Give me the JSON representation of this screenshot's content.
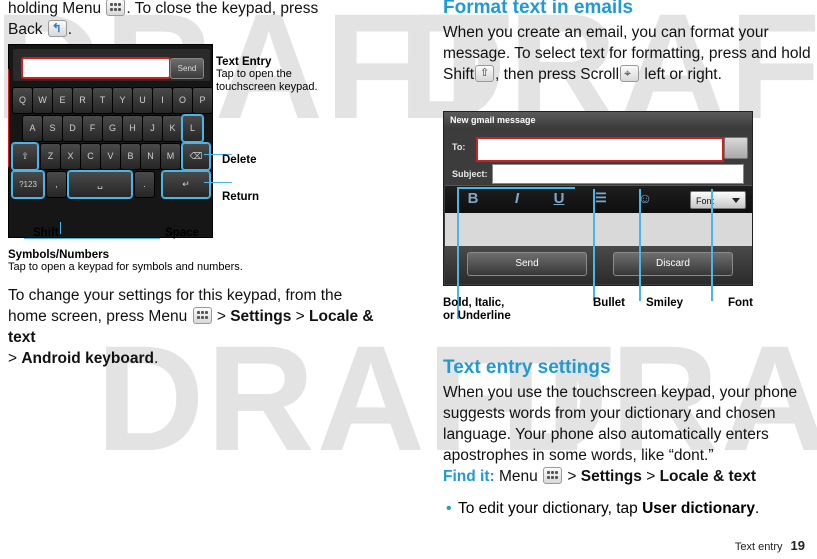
{
  "watermark": {
    "text": "DRAFT"
  },
  "left": {
    "intro_1": "holding Menu",
    "intro_2": ". To close the keypad, press",
    "intro_3": "Back",
    "intro_4": ".",
    "keypad_figure": {
      "send_button": "Send",
      "rows": [
        [
          "Q",
          "W",
          "E",
          "R",
          "T",
          "Y",
          "U",
          "I",
          "O",
          "P"
        ],
        [
          "A",
          "S",
          "D",
          "F",
          "G",
          "H",
          "J",
          "K",
          "L"
        ],
        [
          "Z",
          "X",
          "C",
          "V",
          "B",
          "N",
          "M"
        ],
        [
          "?123",
          ",",
          ".",
          ""
        ]
      ],
      "shift_label": "",
      "delete_label": "DEL",
      "return_label": "",
      "space_label": ""
    },
    "callouts": {
      "text_entry_title": "Text Entry",
      "text_entry_sub": "Tap to open the touchscreen keypad.",
      "delete": "Delete",
      "return": "Return",
      "space": "Space",
      "shift": "Shift",
      "symbols_title": "Symbols/Numbers",
      "symbols_sub": "Tap to open a keypad for symbols and numbers."
    },
    "settings_para": {
      "t1": "To change your settings for this keypad, from the home screen, press Menu",
      "t2": " > ",
      "b1": "Settings",
      "t3": " > ",
      "b2": "Locale & text",
      "t4": " > ",
      "b3": "Android keyboard",
      "t5": "."
    }
  },
  "right": {
    "format_heading": "Format text in emails",
    "format_para_1": "When you create an email, you can format your message. To select text for formatting, press and hold Shift",
    "format_para_2": ", then press Scroll",
    "format_para_3": "left or right.",
    "email_figure": {
      "title": "New gmail message",
      "to_label": "To:",
      "subject_label": "Subject:",
      "bold_icon": "B",
      "italic_icon": "I",
      "underline_icon": "U",
      "bullet_icon": "list-icon",
      "smiley_icon": "☺",
      "font_button": "Font",
      "send_button": "Send",
      "discard_button": "Discard"
    },
    "email_callouts": {
      "bold_italic_underline": "Bold, Italic,\nor Underline",
      "bold_italic_line1": "Bold, Italic,",
      "bold_italic_line2": "or Underline",
      "bullet": "Bullet",
      "smiley": "Smiley",
      "font": "Font"
    },
    "settings_heading": "Text entry settings",
    "settings_para": "When you use the touchscreen keypad, your phone suggests words from your dictionary and chosen language. Your phone also automatically enters apostrophes in some words, like “dont.”",
    "find_it_label": "Find it:",
    "find_it_menu": "Menu",
    "find_it_sep": " > ",
    "find_it_settings": "Settings",
    "find_it_locale": "Locale & text",
    "bullet_1_pre": "To edit your dictionary, tap ",
    "bullet_1_bold": "User dictionary",
    "bullet_1_post": "."
  },
  "footer": {
    "label": "Text entry",
    "page": "19"
  },
  "colors": {
    "accent_blue": "#1f9ad6",
    "callout_blue": "#49b6e8",
    "highlight_red": "#cf2020"
  }
}
